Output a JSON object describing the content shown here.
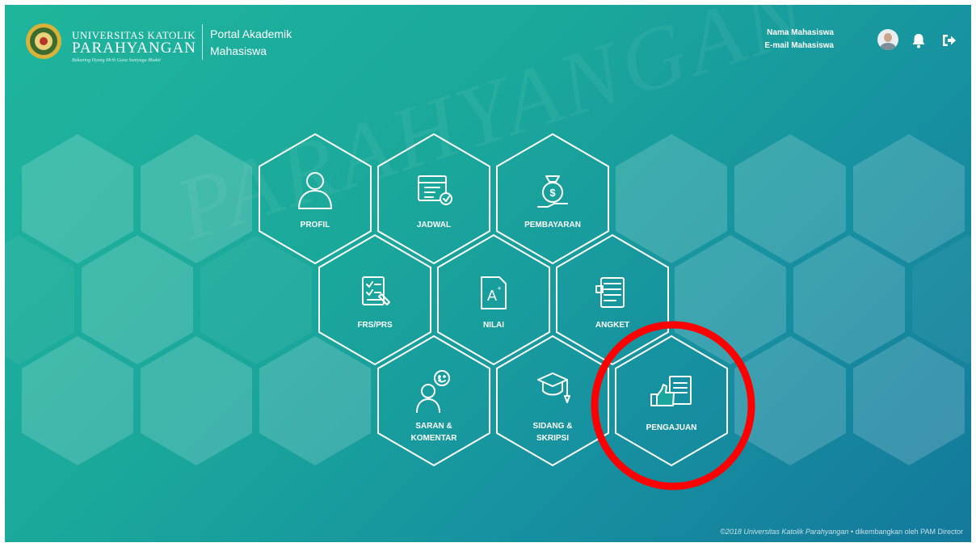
{
  "header": {
    "university_line1": "UNIVERSITAS KATOLIK",
    "university_line2": "PARAHYANGAN",
    "motto": "Bakuning Hyang Mrih Guna Santyaga Bhakti",
    "portal_line1": "Portal Akademik",
    "portal_line2": "Mahasiswa",
    "user_name": "Nama Mahasiswa",
    "user_email": "E-mail Mahasiswa",
    "icons": [
      "avatar",
      "bell-icon",
      "logout-icon"
    ]
  },
  "menu": {
    "tiles": [
      {
        "id": "profil",
        "label": "PROFIL",
        "icon": "user-icon"
      },
      {
        "id": "jadwal",
        "label": "JADWAL",
        "icon": "calendar-icon"
      },
      {
        "id": "pembayaran",
        "label": "PEMBAYARAN",
        "icon": "money-bag-icon"
      },
      {
        "id": "frs-prs",
        "label": "FRS/PRS",
        "icon": "checklist-icon"
      },
      {
        "id": "nilai",
        "label": "NILAI",
        "icon": "grade-document-icon"
      },
      {
        "id": "angket",
        "label": "ANGKET",
        "icon": "questionnaire-icon"
      },
      {
        "id": "saran",
        "label": "SARAN &\nKOMENTAR",
        "label_line1": "SARAN &",
        "label_line2": "KOMENTAR",
        "icon": "chat-person-icon"
      },
      {
        "id": "sidang",
        "label": "SIDANG &\nSKRIPSI",
        "label_line1": "SIDANG &",
        "label_line2": "SKRIPSI",
        "icon": "graduation-cap-icon"
      },
      {
        "id": "pengajuan",
        "label": "PENGAJUAN",
        "icon": "thumbs-up-document-icon",
        "highlighted": true
      }
    ]
  },
  "annotation": {
    "highlight_color": "#ff0000"
  },
  "footer": {
    "copyright": "©2018 Universitas Katolik Parahyangan",
    "credit": " • dikembangkan oleh PAM Director"
  },
  "colors": {
    "accent": "#1fb59c",
    "tile_stroke": "#ffffff"
  }
}
